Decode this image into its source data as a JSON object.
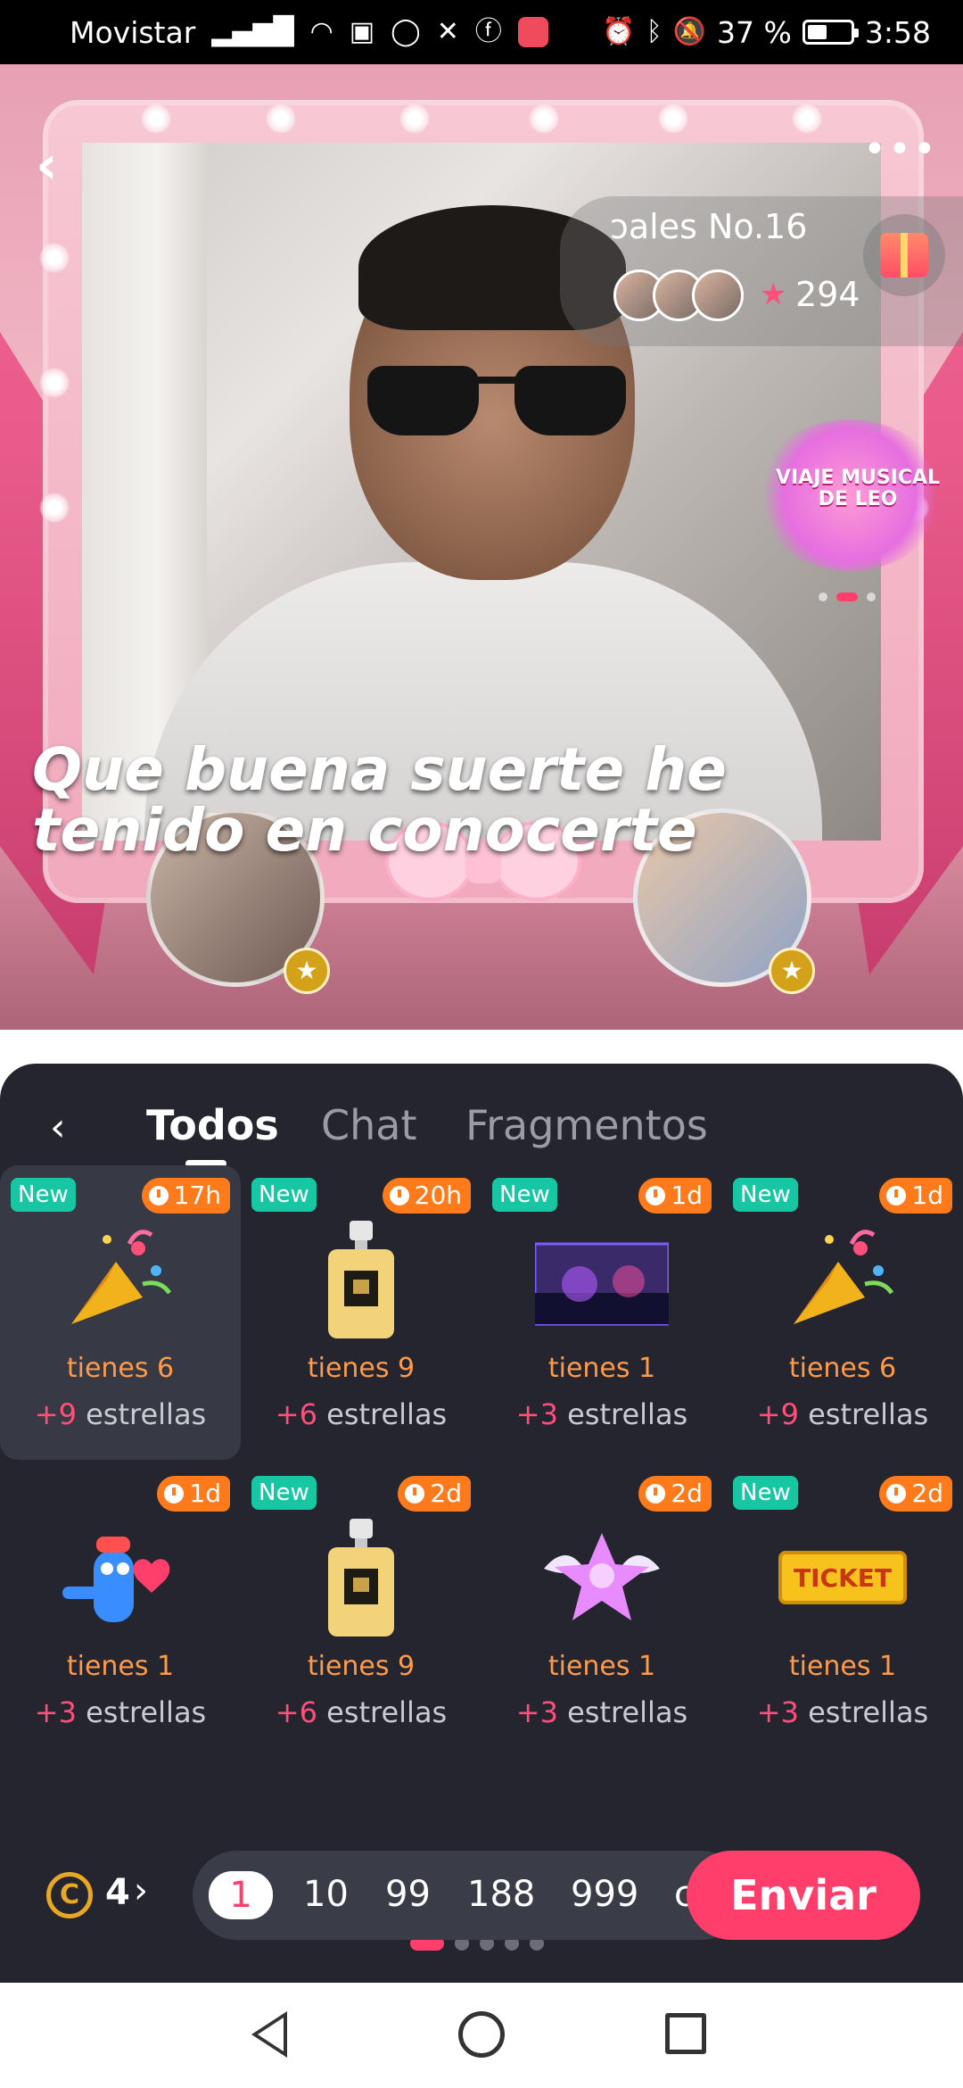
{
  "status_bar": {
    "carrier": "Movistar",
    "battery": "37 %",
    "time": "3:58",
    "icons": [
      "signal-icon",
      "wifi-icon",
      "app-icon",
      "whatsapp-icon",
      "x-icon",
      "facebook-icon",
      "huawei-app-icon",
      "alarm-icon",
      "bluetooth-icon",
      "mute-icon",
      "battery-icon"
    ]
  },
  "live": {
    "rank_title": "ɔales No.16",
    "rank_count": "294",
    "event_text": "VIAJE MUSICAL DE LEO",
    "caption_line1": "Que buena suerte he",
    "caption_line2": "tenido en conocerte"
  },
  "panel": {
    "tabs": [
      {
        "label": "Todos",
        "active": true
      },
      {
        "label": "Chat",
        "active": false
      },
      {
        "label": "Fragmentos",
        "active": false
      }
    ],
    "new_label": "New",
    "gifts": [
      {
        "new": true,
        "time": "17h",
        "count": "tienes 6",
        "plus": "+9",
        "stars": " estrellas",
        "icon": "party-popper-icon",
        "selected": true
      },
      {
        "new": true,
        "time": "20h",
        "count": "tienes 9",
        "plus": "+6",
        "stars": " estrellas",
        "icon": "perfume-icon",
        "selected": false
      },
      {
        "new": true,
        "time": "1d",
        "count": "tienes 1",
        "plus": "+3",
        "stars": " estrellas",
        "icon": "dj-screen-icon",
        "selected": false
      },
      {
        "new": true,
        "time": "1d",
        "count": "tienes 6",
        "plus": "+9",
        "stars": " estrellas",
        "icon": "party-popper-icon",
        "selected": false
      },
      {
        "new": false,
        "time": "1d",
        "count": "tienes 1",
        "plus": "+3",
        "stars": " estrellas",
        "icon": "heart-character-icon",
        "selected": false
      },
      {
        "new": true,
        "time": "2d",
        "count": "tienes 9",
        "plus": "+6",
        "stars": " estrellas",
        "icon": "perfume-icon",
        "selected": false
      },
      {
        "new": false,
        "time": "2d",
        "count": "tienes 1",
        "plus": "+3",
        "stars": " estrellas",
        "icon": "winged-star-icon",
        "selected": false
      },
      {
        "new": true,
        "time": "2d",
        "count": "tienes 1",
        "plus": "+3",
        "stars": " estrellas",
        "icon": "ticket-icon",
        "selected": false
      }
    ],
    "coin_symbol": "C",
    "coins": "4",
    "quantities": [
      "1",
      "10",
      "99",
      "188",
      "999",
      "c"
    ],
    "selected_quantity": "1",
    "send_label": "Enviar"
  },
  "colors": {
    "accent": "#ff3e6c",
    "panel_bg": "#24252f",
    "new_badge": "#17c7a4",
    "time_badge": "#ff7a1a",
    "count_text": "#ff9a4a"
  }
}
